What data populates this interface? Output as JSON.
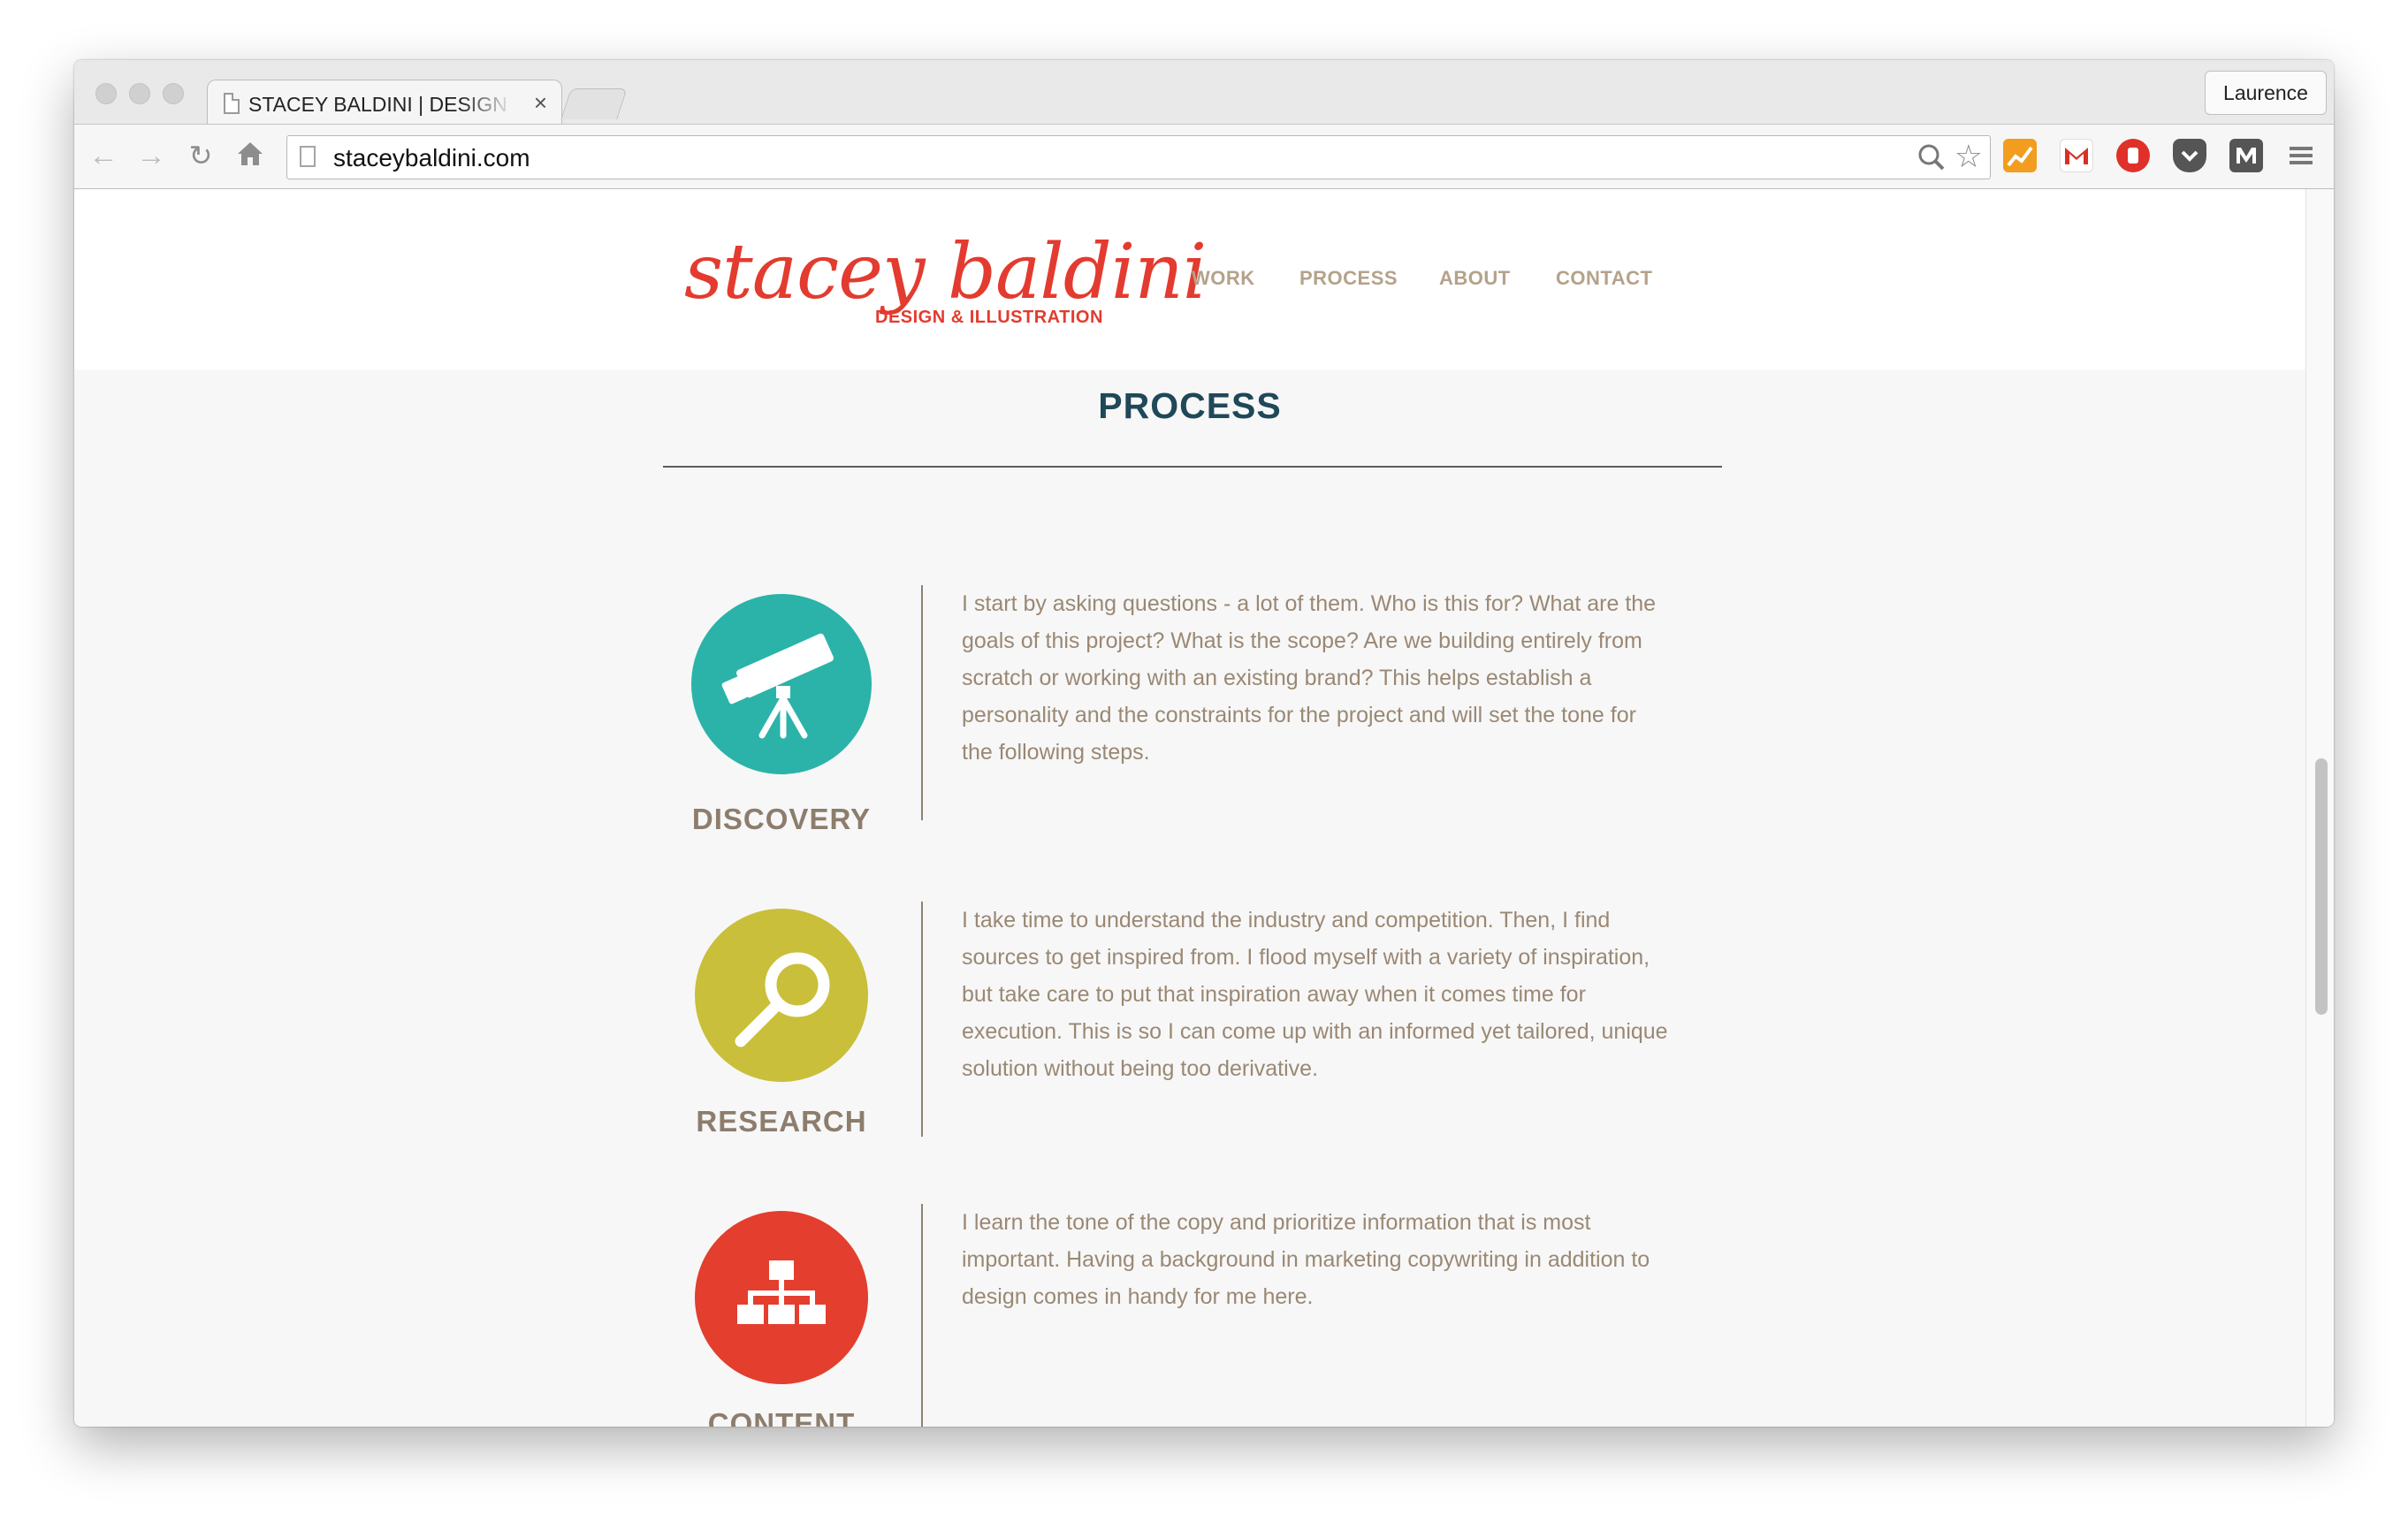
{
  "browser": {
    "tab_title": "STACEY BALDINI | DESIGN & ILLUSTRATION",
    "tab_close": "×",
    "profile_name": "Laurence",
    "url": "staceybaldini.com"
  },
  "site": {
    "logo_script": "stacey baldini",
    "logo_subtitle": "DESIGN & ILLUSTRATION",
    "nav": [
      "WORK",
      "PROCESS",
      "ABOUT",
      "CONTACT"
    ],
    "section_title": "PROCESS"
  },
  "steps": [
    {
      "label": "DISCOVERY",
      "icon": "telescope-icon",
      "color": "#2bb3a9",
      "text": "I start by asking questions - a lot of them. Who is this for? What are the goals of this project? What is the scope? Are we building entirely from scratch or working with an existing brand? This helps establish a personality and the constraints for the project and will set the tone for the following steps."
    },
    {
      "label": "RESEARCH",
      "icon": "magnifying-glass-icon",
      "color": "#c9bf3a",
      "text": "I take time to understand the industry and competition. Then, I find sources to get inspired from. I flood myself with a variety of inspiration, but take care to put that inspiration away when it comes time for execution. This is so I can come up with an informed yet tailored, unique solution without being too derivative."
    },
    {
      "label": "CONTENT",
      "icon": "sitemap-icon",
      "color": "#e33e2e",
      "text": "I learn the tone of the copy and prioritize information that is most important. Having a background in marketing copywriting in addition to design comes in handy for me here."
    }
  ],
  "colors": {
    "brand_red": "#e33b2f",
    "nav_text": "#b4a28a",
    "heading": "#1f4858",
    "body_text": "#9a8874"
  }
}
